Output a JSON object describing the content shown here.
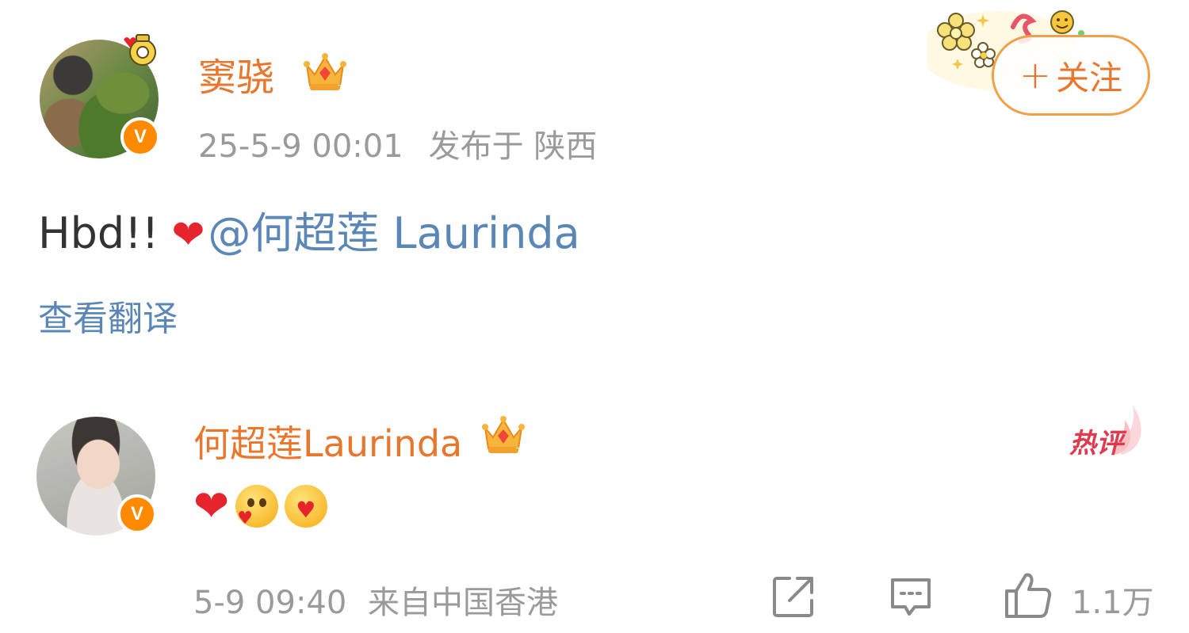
{
  "post": {
    "author": {
      "name": "窦骁",
      "avatar_alt": "user avatar",
      "verified": true,
      "verified_mark": "V"
    },
    "time": "25-5-9 00:01",
    "location": "发布于 陕西",
    "follow_label": "关注",
    "follow_plus": "+",
    "text_prefix": "Hbd!!",
    "heart": "❤",
    "mention": "@何超莲 Laurinda",
    "translate_label": "查看翻译"
  },
  "comment": {
    "author": {
      "name": "何超莲Laurinda",
      "verified": true,
      "verified_mark": "V"
    },
    "hot_label": "热评",
    "heart": "❤",
    "emojis": [
      "heart-icon",
      "blush-heart-emoji-icon",
      "hug-heart-emoji-icon"
    ],
    "time": "5-9 09:40",
    "source": "来自中国香港",
    "like_count": "1.1万"
  },
  "icons": {
    "crown": "crown-icon",
    "repost": "repost-icon",
    "comment": "comment-icon",
    "like": "thumbs-up-icon"
  },
  "colors": {
    "username": "#e8772d",
    "link": "#5a87b6",
    "meta": "#9a9a9a",
    "verified_badge": "#ff8a00",
    "hot": "#e03a4e"
  }
}
